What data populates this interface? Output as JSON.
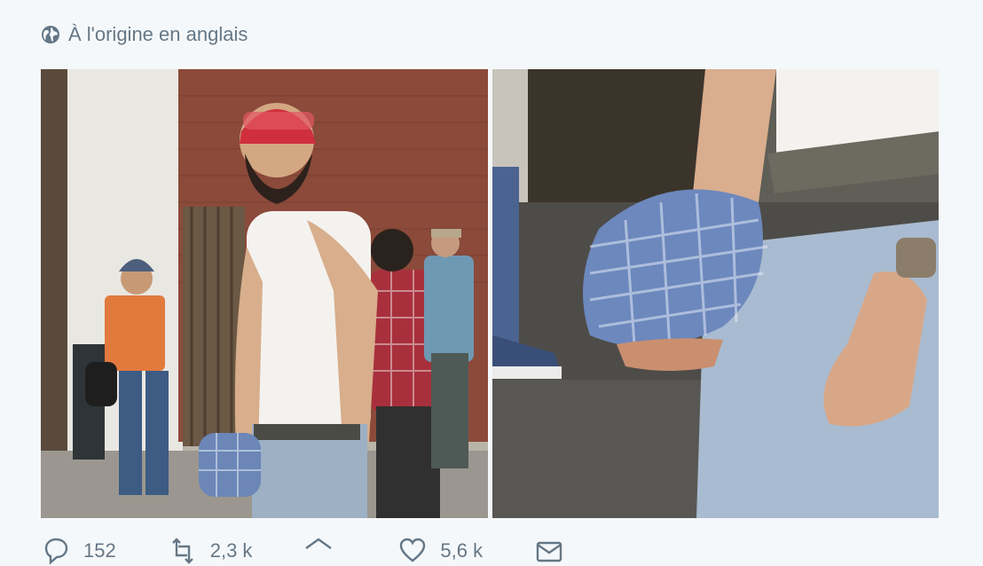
{
  "origin": {
    "icon": "globe-icon",
    "label": "À l'origine en anglais"
  },
  "photos": [
    {
      "name": "tweet-photo-1",
      "subject": "man-in-tank-top"
    },
    {
      "name": "tweet-photo-2",
      "subject": "hand-and-shirt-closeup"
    }
  ],
  "actions": [
    {
      "name": "reply-button",
      "icon": "reply-icon",
      "count": "152"
    },
    {
      "name": "retweet-button",
      "icon": "retweet-icon",
      "count": "2,3 k"
    },
    {
      "name": "share-button",
      "icon": "share-icon",
      "count": ""
    },
    {
      "name": "like-button",
      "icon": "heart-icon",
      "count": "5,6 k"
    },
    {
      "name": "dm-button",
      "icon": "message-icon",
      "count": ""
    }
  ],
  "colors": {
    "muted_text": "#657786",
    "background": "#f5f8fa"
  }
}
